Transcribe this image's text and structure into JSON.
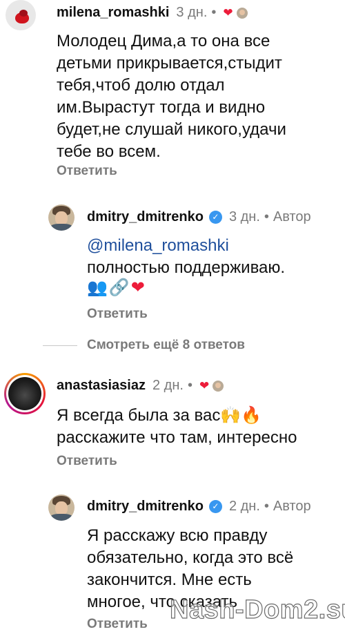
{
  "comments": [
    {
      "username": "milena_romashki",
      "time": "3 дн.",
      "dot": "•",
      "text_lines": [
        "Молодец Дима,а то она все",
        "детьми прикрывается,стыдит",
        "тебя,чтоб долю отдал",
        "им.Вырастут тогда и видно",
        "будет,не слушай никого,удачи",
        "тебе во всем."
      ],
      "reply_label": "Ответить",
      "liked_icon": "heart-icon",
      "heart_color": "#ed1c3a"
    },
    {
      "username": "dmitry_dmitrenko",
      "time": "3 дн.",
      "dot": "•",
      "author_label": "Автор",
      "mention": "@milena_romashki",
      "text_line": "полностью поддерживаю.",
      "emojis": [
        "users-emoji",
        "link-emoji",
        "heart-emoji"
      ],
      "reply_label": "Ответить"
    },
    {
      "username": "anastasiasiaz",
      "time": "2 дн.",
      "dot": "•",
      "text_line1": "Я всегда была за вас",
      "text_line2": "расскажите что там, интересно",
      "emojis": [
        "raising-hands-emoji",
        "fire-emoji"
      ],
      "reply_label": "Ответить"
    },
    {
      "username": "dmitry_dmitrenko",
      "time": "2 дн.",
      "dot": "•",
      "author_label": "Автор",
      "text_lines": [
        "Я расскажу всю правду",
        "обязательно, когда это всё",
        "закончится. Мне есть",
        "многое, что сказать"
      ],
      "reply_label": "Ответить"
    }
  ],
  "view_more": "Смотреть ещё 8 ответов",
  "watermark": "Nash-Dom2.su",
  "colors": {
    "verified": "#3897f0",
    "mention": "#1f4f9c",
    "muted": "#7a7a7a"
  }
}
